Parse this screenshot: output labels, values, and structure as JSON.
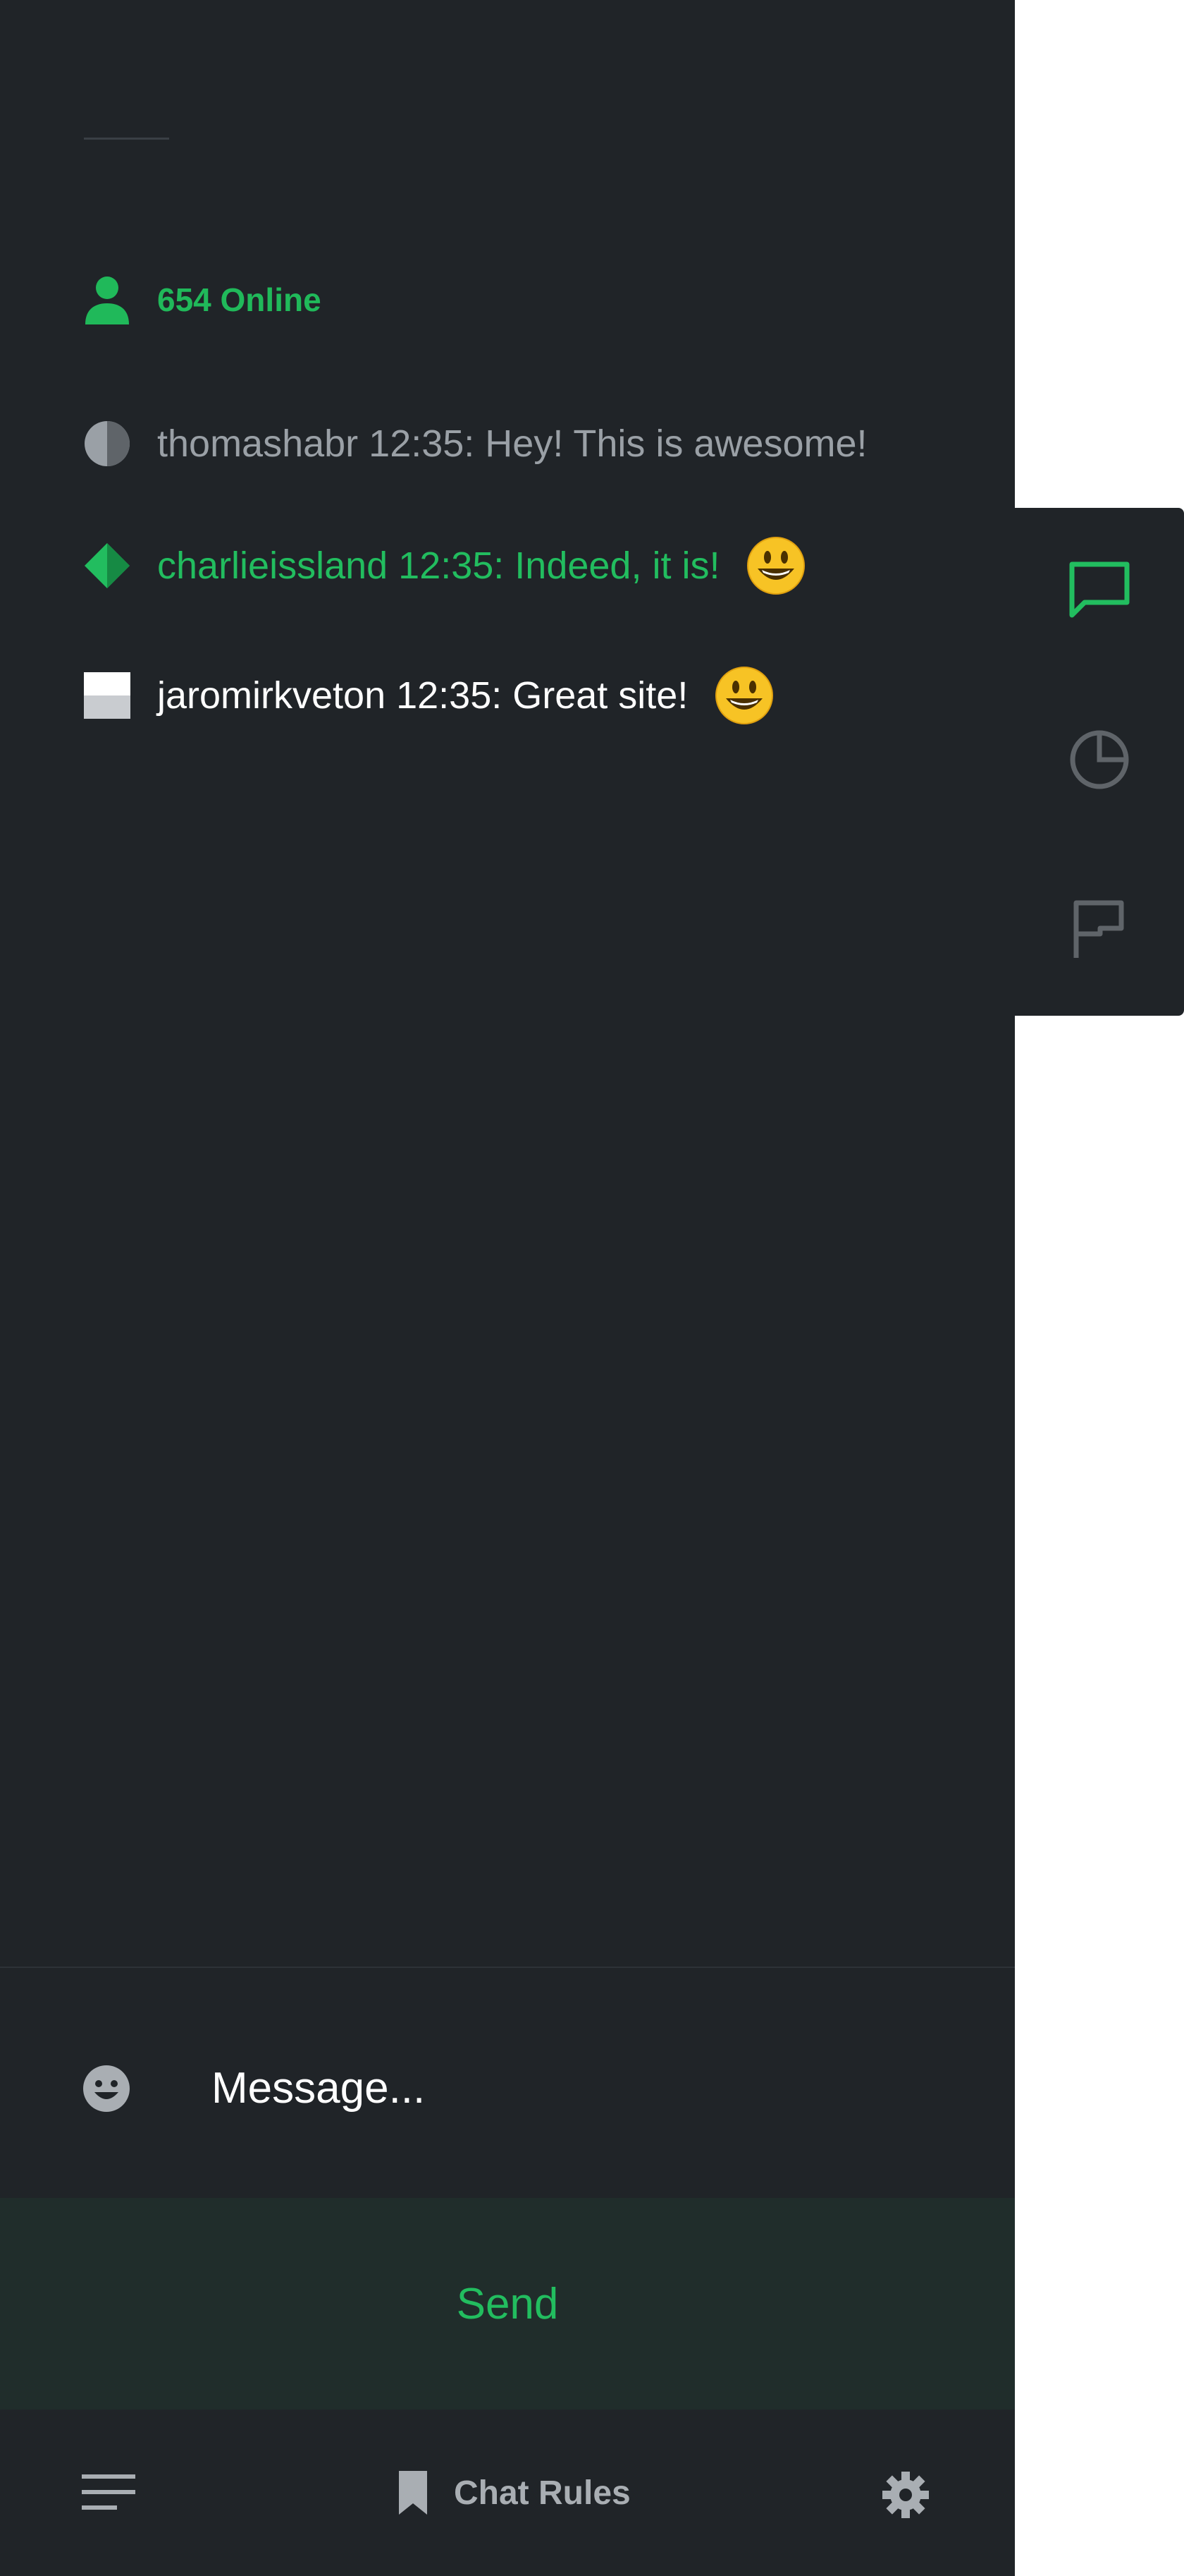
{
  "colors": {
    "panel_bg": "#202428",
    "accent": "#22bd5f",
    "muted_text": "#9aa0a6",
    "send_bg": "#202d2b"
  },
  "online": {
    "icon": "user-icon",
    "text": "654 Online"
  },
  "messages": [
    {
      "icon": "half-circle-icon",
      "text": "thomashabr 12:35: Hey! This is awesome!",
      "emoji": null
    },
    {
      "icon": "diamond-icon",
      "text": "charlieissland 12:35: Indeed, it is!",
      "emoji": "smiley-emoji"
    },
    {
      "icon": "half-square-icon",
      "text": "jaromirkveton 12:35: Great site!",
      "emoji": "smiley-emoji"
    }
  ],
  "composer": {
    "emoji_icon": "smiley-face-icon",
    "placeholder": "Message..."
  },
  "send_label": "Send",
  "bottom_bar": {
    "menu_icon": "menu-lines-icon",
    "rules_icon": "bookmark-icon",
    "rules_label": "Chat Rules",
    "settings_icon": "gear-icon"
  },
  "side_rail": [
    {
      "icon": "chat-bubble-icon",
      "active": true
    },
    {
      "icon": "pie-chart-icon",
      "active": false
    },
    {
      "icon": "flag-icon",
      "active": false
    }
  ]
}
